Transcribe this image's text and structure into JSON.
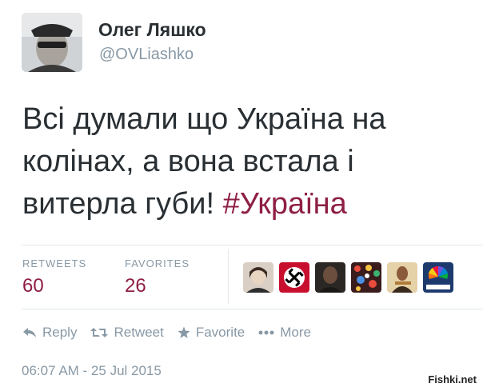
{
  "author": {
    "name": "Олег Ляшко",
    "handle": "@OVLiashko"
  },
  "tweet": {
    "text_before": "Всі думали що Україна на колінах, а вона встала і витерла губи! ",
    "hashtag": "#Україна"
  },
  "stats": {
    "retweets_label": "RETWEETS",
    "retweets_count": "60",
    "favorites_label": "FAVORITES",
    "favorites_count": "26",
    "favoriters": [
      "person-avatar-icon",
      "swastika-avatar-icon",
      "dark-person-avatar-icon",
      "colorful-pattern-avatar-icon",
      "guitarist-avatar-icon",
      "nbc-news-avatar-icon"
    ]
  },
  "actions": {
    "reply": "Reply",
    "retweet": "Retweet",
    "favorite": "Favorite",
    "more": "More"
  },
  "timestamp": "06:07 AM - 25 Jul 2015",
  "watermark": "Fishki.net",
  "colors": {
    "hashtag": "#8e1f44",
    "count": "#8e1f44",
    "muted": "#8899a6"
  }
}
